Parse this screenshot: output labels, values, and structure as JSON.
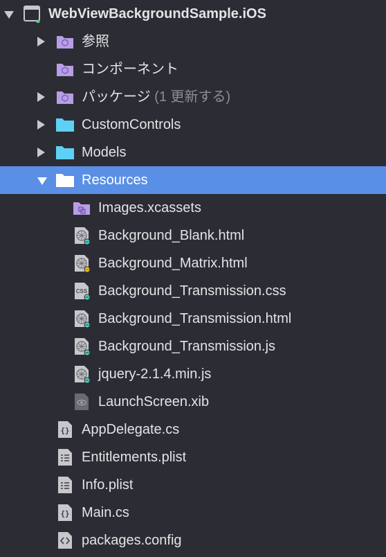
{
  "colors": {
    "background": "#2c2d34",
    "selection": "#5a8fe6",
    "folder": "#5fd0f5",
    "special_folder": "#b89ee6",
    "file": "#c8c8cc"
  },
  "tree": {
    "project": {
      "label": "WebViewBackgroundSample.iOS",
      "expanded": true,
      "icon": "project-icon"
    },
    "refs": {
      "label": "参照",
      "expanded": false,
      "icon": "references-folder-icon"
    },
    "components": {
      "label": "コンポーネント",
      "icon": "components-folder-icon"
    },
    "packages": {
      "label": "パッケージ",
      "note": "(1 更新する)",
      "expanded": false,
      "icon": "packages-folder-icon"
    },
    "custom_controls": {
      "label": "CustomControls",
      "expanded": false,
      "icon": "folder-icon"
    },
    "models": {
      "label": "Models",
      "expanded": false,
      "icon": "folder-icon"
    },
    "resources": {
      "label": "Resources",
      "expanded": true,
      "selected": true,
      "icon": "folder-icon"
    },
    "images": {
      "label": "Images.xcassets",
      "icon": "asset-catalog-icon"
    },
    "bg_blank": {
      "label": "Background_Blank.html",
      "icon": "web-file-icon"
    },
    "bg_matrix": {
      "label": "Background_Matrix.html",
      "icon": "web-file-icon"
    },
    "bg_trans_css": {
      "label": "Background_Transmission.css",
      "icon": "css-file-icon",
      "icon_text": "CSS"
    },
    "bg_trans_html": {
      "label": "Background_Transmission.html",
      "icon": "web-file-icon"
    },
    "bg_trans_js": {
      "label": "Background_Transmission.js",
      "icon": "web-file-icon"
    },
    "jquery": {
      "label": "jquery-2.1.4.min.js",
      "icon": "web-file-icon"
    },
    "launch": {
      "label": "LaunchScreen.xib",
      "icon": "xib-file-icon"
    },
    "appdelegate": {
      "label": "AppDelegate.cs",
      "icon": "csharp-file-icon"
    },
    "entitlements": {
      "label": "Entitlements.plist",
      "icon": "plist-file-icon"
    },
    "info": {
      "label": "Info.plist",
      "icon": "plist-file-icon"
    },
    "main": {
      "label": "Main.cs",
      "icon": "csharp-file-icon"
    },
    "packages_config": {
      "label": "packages.config",
      "icon": "config-file-icon"
    }
  }
}
